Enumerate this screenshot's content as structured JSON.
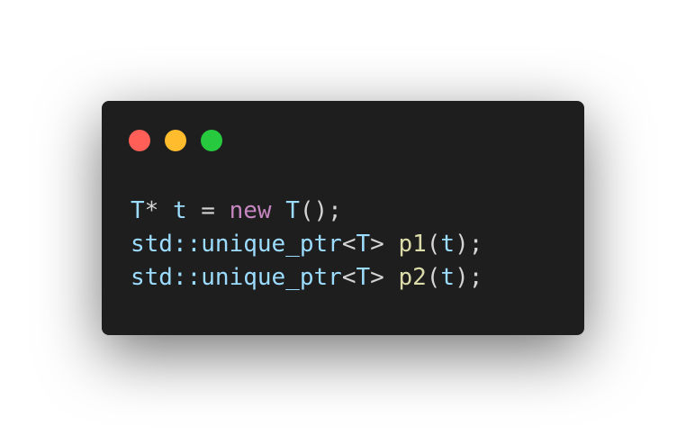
{
  "window": {
    "background": "#1e1e1e",
    "controls": [
      {
        "name": "close-dot",
        "color": "#ff5f56"
      },
      {
        "name": "minimize-dot",
        "color": "#ffbd2e"
      },
      {
        "name": "maximize-dot",
        "color": "#27c93f"
      }
    ]
  },
  "palette": {
    "default": "#d4d4d4",
    "type": "#9cdcfe",
    "keyword": "#c586c0",
    "function": "#dcdcaa"
  },
  "code": {
    "lines": [
      [
        {
          "text": "T",
          "color": "type"
        },
        {
          "text": "* ",
          "color": "default"
        },
        {
          "text": "t",
          "color": "type"
        },
        {
          "text": " = ",
          "color": "default"
        },
        {
          "text": "new",
          "color": "keyword"
        },
        {
          "text": " ",
          "color": "default"
        },
        {
          "text": "T",
          "color": "type"
        },
        {
          "text": "();",
          "color": "default"
        }
      ],
      [
        {
          "text": "std::unique_ptr",
          "color": "type"
        },
        {
          "text": "<",
          "color": "default"
        },
        {
          "text": "T",
          "color": "type"
        },
        {
          "text": "> ",
          "color": "default"
        },
        {
          "text": "p1",
          "color": "function"
        },
        {
          "text": "(",
          "color": "default"
        },
        {
          "text": "t",
          "color": "type"
        },
        {
          "text": ");",
          "color": "default"
        }
      ],
      [
        {
          "text": "std::unique_ptr",
          "color": "type"
        },
        {
          "text": "<",
          "color": "default"
        },
        {
          "text": "T",
          "color": "type"
        },
        {
          "text": "> ",
          "color": "default"
        },
        {
          "text": "p2",
          "color": "function"
        },
        {
          "text": "(",
          "color": "default"
        },
        {
          "text": "t",
          "color": "type"
        },
        {
          "text": ");",
          "color": "default"
        }
      ]
    ]
  }
}
